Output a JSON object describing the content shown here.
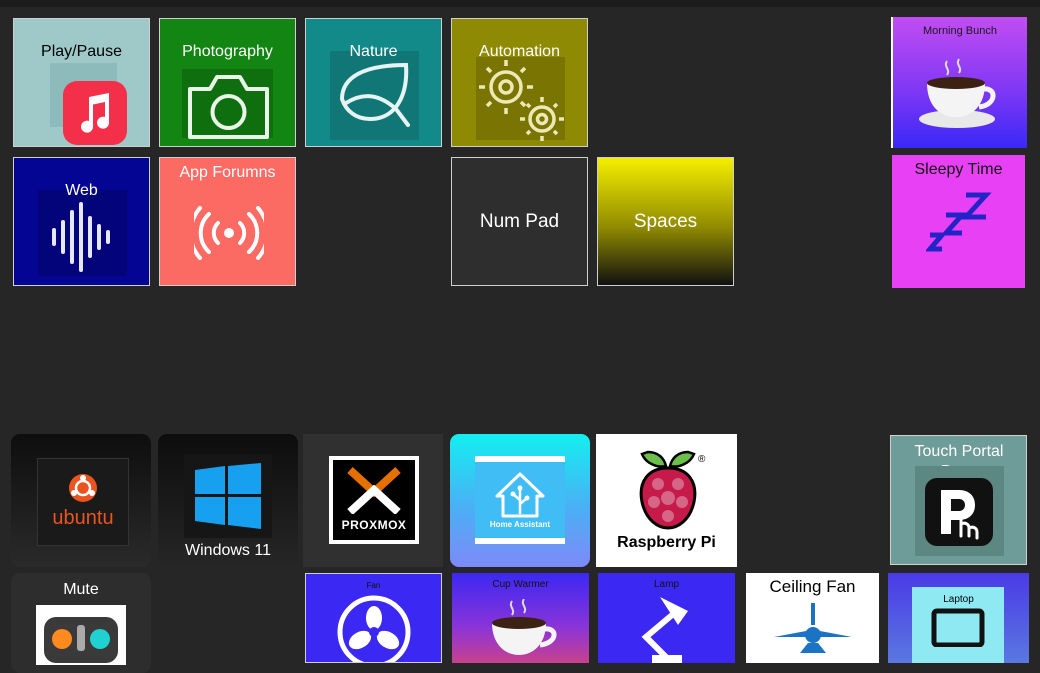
{
  "tiles": {
    "play_pause": {
      "label": "Play/Pause",
      "icon": "music-icon"
    },
    "photography": {
      "label": "Photography",
      "icon": "camera-icon"
    },
    "nature": {
      "label": "Nature",
      "icon": "leaf-icon"
    },
    "automation": {
      "label": "Automation",
      "icon": "gears-icon"
    },
    "morning_bunch": {
      "label": "Morning Bunch",
      "icon": "coffee-icon"
    },
    "web": {
      "label": "Web",
      "icon": "soundwave-icon"
    },
    "app_forums": {
      "label": "App Forumns",
      "icon": "broadcast-icon"
    },
    "num_pad": {
      "label": "Num Pad"
    },
    "spaces": {
      "label": "Spaces"
    },
    "sleepy_time": {
      "label": "Sleepy Time",
      "icon": "zzz-icon"
    },
    "ubuntu": {
      "label": "ubuntu",
      "icon": "ubuntu-icon"
    },
    "windows11": {
      "label": "Windows 11",
      "icon": "windows-icon"
    },
    "proxmox": {
      "label": "PROXMOX",
      "icon": "proxmox-icon"
    },
    "home_assistant": {
      "label": "Home Assistant",
      "icon": "home-assistant-icon"
    },
    "raspberry_pi": {
      "label": "Raspberry Pi",
      "icon": "raspberry-icon"
    },
    "touch_portal": {
      "label": "Touch Portal Docs",
      "icon": "touch-portal-icon"
    },
    "mute": {
      "label": "Mute",
      "icon": "mixer-icon"
    },
    "fan": {
      "label": "Fan",
      "icon": "fan-icon"
    },
    "cup_warmer": {
      "label": "Cup Warmer",
      "icon": "coffee-icon"
    },
    "lamp": {
      "label": "Lamp",
      "icon": "lamp-icon"
    },
    "ceiling_fan": {
      "label": "Ceiling Fan",
      "icon": "ceiling-fan-icon"
    },
    "laptop": {
      "label": "Laptop",
      "icon": "laptop-icon"
    }
  },
  "colors": {
    "background": "#262626",
    "play_pause_bg": "#9fc9c9",
    "photography_bg": "#128512",
    "nature_bg": "#138a8a",
    "automation_bg": "#8f8a03",
    "web_bg": "#050594",
    "app_forums_bg": "#fc6a64",
    "sleepy_bg": "#e840f5"
  }
}
